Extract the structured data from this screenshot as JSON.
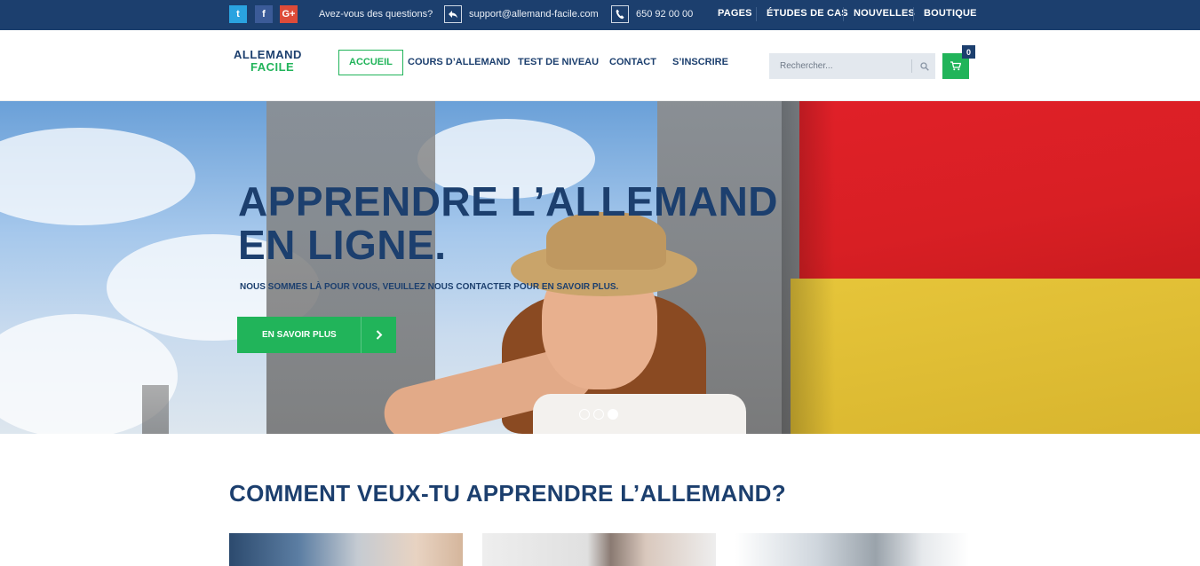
{
  "topbar": {
    "social": [
      {
        "name": "twitter",
        "glyph": "t"
      },
      {
        "name": "facebook",
        "glyph": "f"
      },
      {
        "name": "google-plus",
        "glyph": "G+"
      }
    ],
    "question": "Avez-vous des questions?",
    "email": "support@allemand-facile.com",
    "phone": "650 92 00 00",
    "menu": [
      "PAGES",
      "ÉTUDES DE CAS",
      "NOUVELLES",
      "BOUTIQUE"
    ],
    "background": "#1c3f6e"
  },
  "header": {
    "logo_line1": "ALLEMAND",
    "logo_line2": "FACILE",
    "nav": [
      "ACCUEIL",
      "COURS D’ALLEMAND",
      "TEST DE NIVEAU",
      "CONTACT",
      "S’INSCRIRE"
    ],
    "active_nav": "ACCUEIL",
    "search_placeholder": "Rechercher...",
    "cart_count": "0"
  },
  "hero": {
    "title_line1": "APPRENDRE L’ALLEMAND",
    "title_line2": "EN LIGNE.",
    "subtitle": "NOUS SOMMES LÀ POUR VOUS, VEUILLEZ NOUS CONTACTER POUR EN SAVOIR PLUS.",
    "button_label": "EN SAVOIR PLUS",
    "slides": 3,
    "active_slide": 3
  },
  "section": {
    "title": "COMMENT VEUX-TU APPRENDRE L’ALLEMAND?"
  },
  "colors": {
    "brand_blue": "#1c3f6e",
    "brand_green": "#21b45a"
  }
}
